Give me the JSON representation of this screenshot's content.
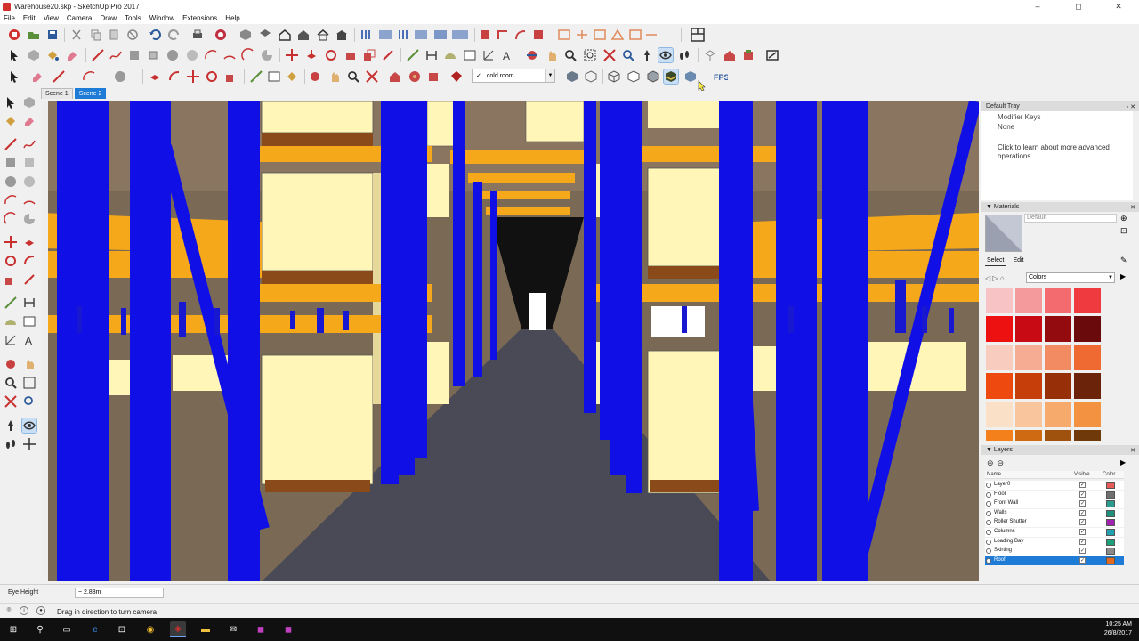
{
  "window": {
    "title": "Warehouse20.skp - SketchUp Pro 2017",
    "controls": [
      "–",
      "◻",
      "✕"
    ]
  },
  "menu": [
    "File",
    "Edit",
    "View",
    "Camera",
    "Draw",
    "Tools",
    "Window",
    "Extensions",
    "Help"
  ],
  "layer_dropdown": {
    "check": "✓",
    "value": "cold room"
  },
  "scene_tabs": [
    {
      "label": "Scene 1",
      "active": false
    },
    {
      "label": "Scene 2",
      "active": true
    }
  ],
  "tray": {
    "title": "Default Tray",
    "instructor": {
      "heading": "Modifier Keys",
      "heading_sub": "None",
      "body": "Click to learn about more advanced operations..."
    },
    "materials": {
      "title": "Materials",
      "current_name": "Default",
      "tabs": [
        "Select",
        "Edit"
      ],
      "library": "Colors",
      "swatches": [
        "#f7c3c4",
        "#f49a9c",
        "#f36b6f",
        "#ef3b40",
        "#ee1111",
        "#c80a14",
        "#940b0f",
        "#6b0a0c",
        "#f8cdc0",
        "#f6ac92",
        "#f28a62",
        "#ef6a33",
        "#ee4a10",
        "#c63e0a",
        "#973009",
        "#6b2409",
        "#fbe0c8",
        "#f9c59c",
        "#f6ab6d",
        "#f39241",
        "#f3801a",
        "#d06a12",
        "#9e520e",
        "#70390a"
      ]
    },
    "layers": {
      "title": "Layers",
      "add_icon": "⊕",
      "remove_icon": "⊖",
      "col_name": "Name",
      "col_visible": "Visible",
      "col_color": "Color",
      "rows": [
        {
          "name": "Layer0",
          "color": "#e75a5a",
          "selected": false
        },
        {
          "name": "Floor",
          "color": "#6f6f6f",
          "selected": false
        },
        {
          "name": "Front Wall",
          "color": "#2a9a8e",
          "selected": false
        },
        {
          "name": "Walls",
          "color": "#1e8f7a",
          "selected": false
        },
        {
          "name": "Roller Shutter",
          "color": "#a020b0",
          "selected": false
        },
        {
          "name": "Columns",
          "color": "#20a0b0",
          "selected": false
        },
        {
          "name": "Loading Bay",
          "color": "#1aa07a",
          "selected": false
        },
        {
          "name": "Skirting",
          "color": "#8a8a8a",
          "selected": false
        },
        {
          "name": "Roof",
          "color": "#e06a20",
          "selected": true
        }
      ]
    }
  },
  "vcb": {
    "label": "Eye Height",
    "value": "~ 2.88m"
  },
  "status": {
    "text": "Drag in direction to turn camera"
  },
  "taskbar": {
    "time": "10:25 AM",
    "date": "26/8/2017"
  }
}
